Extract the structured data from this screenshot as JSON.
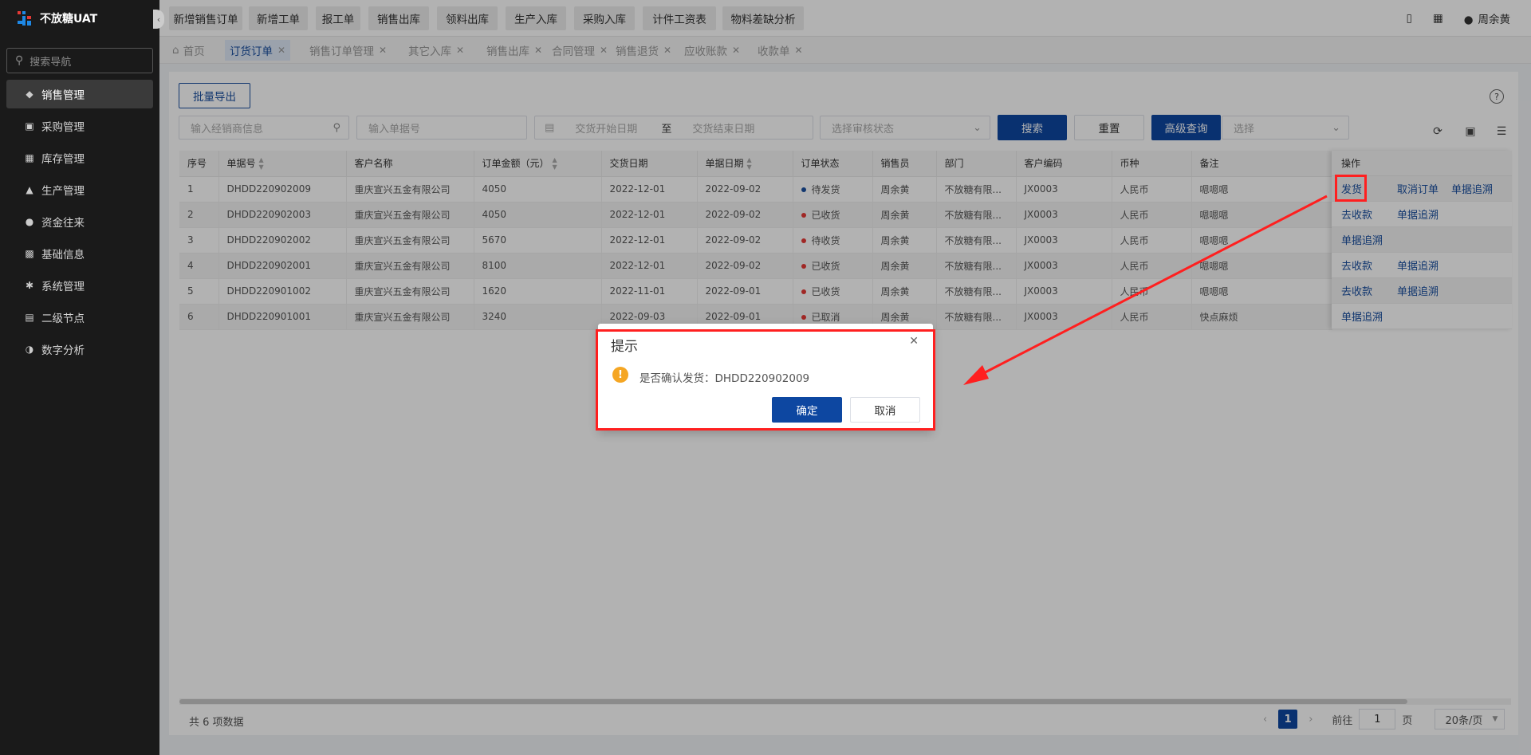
{
  "app": {
    "title": "不放糖UAT"
  },
  "sidebar": {
    "search_placeholder": "搜索导航",
    "items": [
      {
        "label": "销售管理",
        "icon": "tag-icon"
      },
      {
        "label": "采购管理",
        "icon": "cart-icon"
      },
      {
        "label": "库存管理",
        "icon": "warehouse-icon"
      },
      {
        "label": "生产管理",
        "icon": "factory-icon"
      },
      {
        "label": "资金往来",
        "icon": "money-icon"
      },
      {
        "label": "基础信息",
        "icon": "grid-icon"
      },
      {
        "label": "系统管理",
        "icon": "settings-icon"
      },
      {
        "label": "二级节点",
        "icon": "document-icon"
      },
      {
        "label": "数字分析",
        "icon": "pie-chart-icon"
      }
    ]
  },
  "quicklinks": [
    "新增销售订单",
    "新增工单",
    "报工单",
    "销售出库",
    "领料出库",
    "生产入库",
    "采购入库",
    "计件工资表",
    "物料差缺分析"
  ],
  "user": {
    "name": "周余黄"
  },
  "tabs": [
    {
      "label": "首页"
    },
    {
      "label": "订货订单"
    },
    {
      "label": "销售订单管理"
    },
    {
      "label": "其它入库"
    },
    {
      "label": "销售出库"
    },
    {
      "label": "合同管理"
    },
    {
      "label": "销售退货"
    },
    {
      "label": "应收账款"
    },
    {
      "label": "收款单"
    }
  ],
  "toolbar": {
    "export_label": "批量导出",
    "dealer_placeholder": "输入经销商信息",
    "docno_placeholder": "输入单据号",
    "start_date_placeholder": "交货开始日期",
    "date_sep": "至",
    "end_date_placeholder": "交货结束日期",
    "status_placeholder": "选择审核状态",
    "search_label": "搜索",
    "reset_label": "重置",
    "advanced_label": "高级查询",
    "select_placeholder": "选择"
  },
  "table": {
    "columns": [
      "序号",
      "单据号",
      "客户名称",
      "订单金额（元）",
      "交货日期",
      "单据日期",
      "订单状态",
      "销售员",
      "部门",
      "客户编码",
      "币种",
      "备注"
    ],
    "ops_header": "操作",
    "rows": [
      {
        "idx": "1",
        "no": "DHDD220902009",
        "customer": "重庆宣兴五金有限公司",
        "amount": "4050",
        "delivery": "2022-12-01",
        "date": "2022-09-02",
        "status": "待发货",
        "status_color": "#1a4fa0",
        "sales": "周余黄",
        "dept": "不放糖有限...",
        "code": "JX0003",
        "currency": "人民币",
        "remark": "嗯嗯嗯",
        "ops": [
          "发货",
          "取消订单",
          "单据追溯"
        ]
      },
      {
        "idx": "2",
        "no": "DHDD220902003",
        "customer": "重庆宣兴五金有限公司",
        "amount": "4050",
        "delivery": "2022-12-01",
        "date": "2022-09-02",
        "status": "已收货",
        "status_color": "#e53935",
        "sales": "周余黄",
        "dept": "不放糖有限...",
        "code": "JX0003",
        "currency": "人民币",
        "remark": "嗯嗯嗯",
        "ops": [
          "去收款",
          "单据追溯"
        ]
      },
      {
        "idx": "3",
        "no": "DHDD220902002",
        "customer": "重庆宣兴五金有限公司",
        "amount": "5670",
        "delivery": "2022-12-01",
        "date": "2022-09-02",
        "status": "待收货",
        "status_color": "#e53935",
        "sales": "周余黄",
        "dept": "不放糖有限...",
        "code": "JX0003",
        "currency": "人民币",
        "remark": "嗯嗯嗯",
        "ops": [
          "单据追溯"
        ]
      },
      {
        "idx": "4",
        "no": "DHDD220902001",
        "customer": "重庆宣兴五金有限公司",
        "amount": "8100",
        "delivery": "2022-12-01",
        "date": "2022-09-02",
        "status": "已收货",
        "status_color": "#e53935",
        "sales": "周余黄",
        "dept": "不放糖有限...",
        "code": "JX0003",
        "currency": "人民币",
        "remark": "嗯嗯嗯",
        "ops": [
          "去收款",
          "单据追溯"
        ]
      },
      {
        "idx": "5",
        "no": "DHDD220901002",
        "customer": "重庆宣兴五金有限公司",
        "amount": "1620",
        "delivery": "2022-11-01",
        "date": "2022-09-01",
        "status": "已收货",
        "status_color": "#e53935",
        "sales": "周余黄",
        "dept": "不放糖有限...",
        "code": "JX0003",
        "currency": "人民币",
        "remark": "嗯嗯嗯",
        "ops": [
          "去收款",
          "单据追溯"
        ]
      },
      {
        "idx": "6",
        "no": "DHDD220901001",
        "customer": "重庆宣兴五金有限公司",
        "amount": "3240",
        "delivery": "2022-09-03",
        "date": "2022-09-01",
        "status": "已取消",
        "status_color": "#e53935",
        "sales": "周余黄",
        "dept": "不放糖有限...",
        "code": "JX0003",
        "currency": "人民币",
        "remark": "快点麻烦",
        "ops": [
          "单据追溯"
        ]
      }
    ]
  },
  "footer": {
    "total": "共 6 项数据",
    "current_page": "1",
    "goto_label": "前往",
    "goto_value": "1",
    "page_unit": "页",
    "page_size": "20条/页"
  },
  "dialog": {
    "title": "提示",
    "message": "是否确认发货：DHDD220902009",
    "confirm": "确定",
    "cancel": "取消"
  },
  "annotation_color": "#ff1f1f"
}
